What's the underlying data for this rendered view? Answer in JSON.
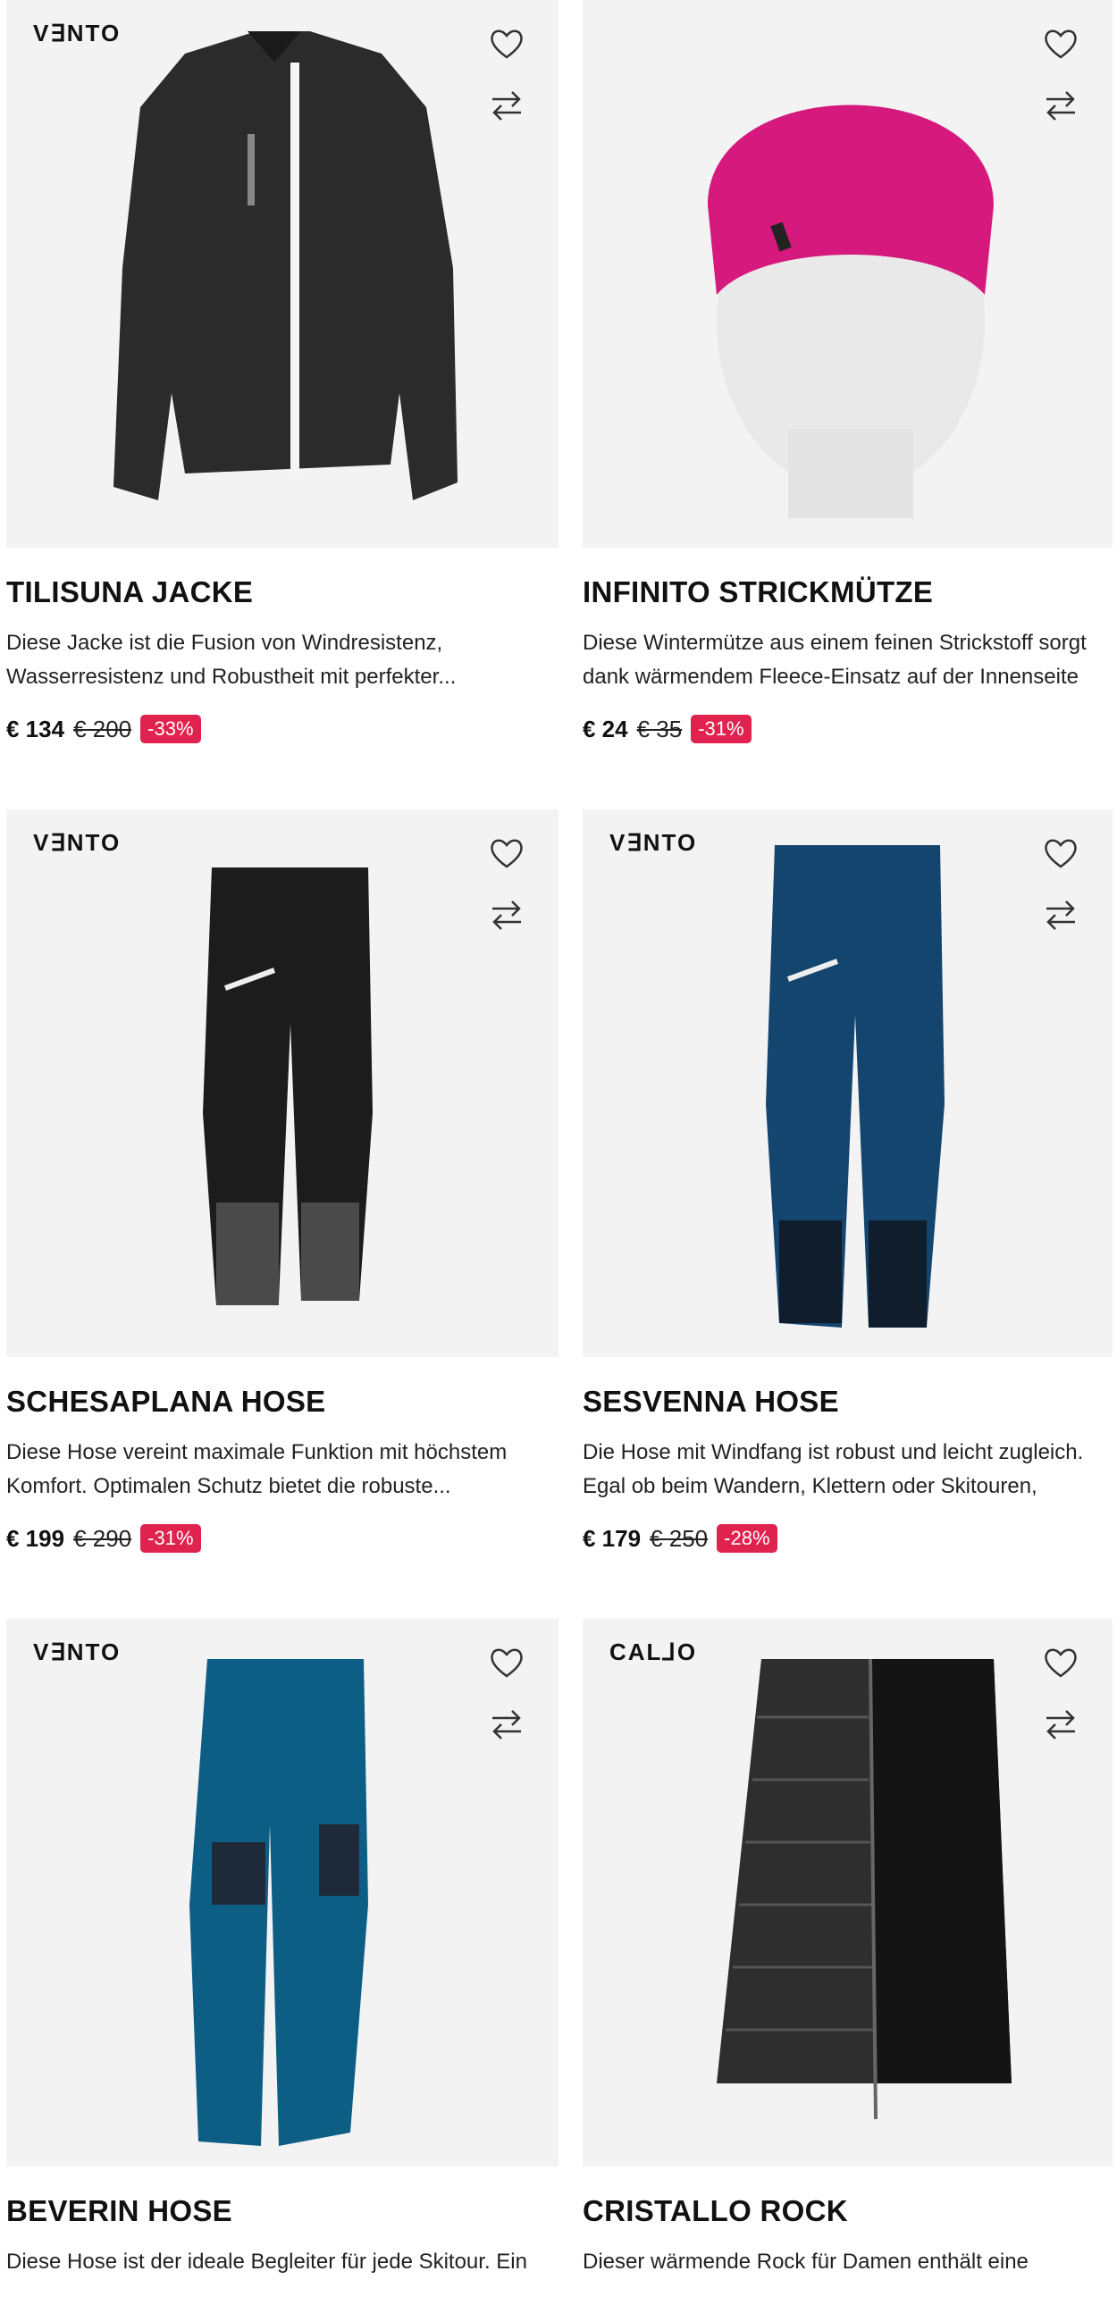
{
  "products": [
    {
      "brand": "V∃NTO",
      "title": "TILISUNA JACKE",
      "description": "Diese Jacke ist die Fusion von Windresistenz, Wasserresistenz und Robustheit mit perfekter...",
      "price": "€ 134",
      "old_price": "€ 200",
      "discount": "-33%"
    },
    {
      "brand": "",
      "title": "INFINITO STRICKMÜTZE",
      "description": "Diese Wintermütze aus einem feinen Strickstoff sorgt dank wärmendem Fleece-Einsatz auf der Innenseite fü...",
      "price": "€ 24",
      "old_price": "€ 35",
      "discount": "-31%"
    },
    {
      "brand": "V∃NTO",
      "title": "SCHESAPLANA HOSE",
      "description": "Diese Hose vereint maximale Funktion mit höchstem Komfort. Optimalen Schutz bietet die robuste...",
      "price": "€ 199",
      "old_price": "€ 290",
      "discount": "-31%"
    },
    {
      "brand": "V∃NTO",
      "title": "SESVENNA HOSE",
      "description": "Die Hose mit Windfang ist robust und leicht zugleich. Egal ob beim Wandern, Klettern oder Skitouren, Wärm...",
      "price": "€ 179",
      "old_price": "€ 250",
      "discount": "-28%"
    },
    {
      "brand": "V∃NTO",
      "title": "BEVERIN HOSE",
      "description": "Diese Hose ist der ideale Begleiter für jede Skitour. Ein",
      "price": "",
      "old_price": "",
      "discount": ""
    },
    {
      "brand": "CAL⅃O",
      "title": "CRISTALLO ROCK",
      "description": "Dieser wärmende Rock für Damen enthält eine",
      "price": "",
      "old_price": "",
      "discount": ""
    }
  ],
  "icons": {
    "wishlist": "heart-icon",
    "compare": "compare-arrows-icon"
  },
  "colors": {
    "discount_badge": "#e0224e",
    "image_background": "#f3f3f3"
  }
}
